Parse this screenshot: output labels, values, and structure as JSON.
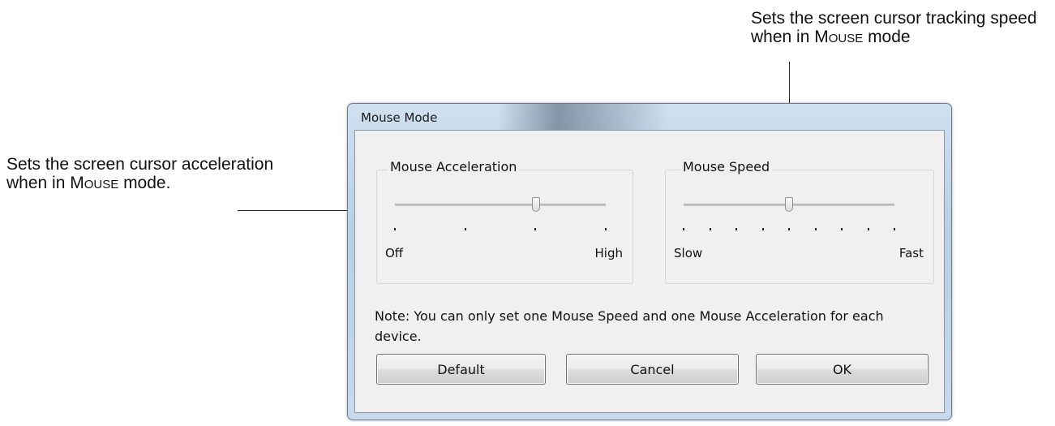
{
  "callouts": {
    "left_prefix": "Sets the screen cursor acceleration when in ",
    "left_mode": "Mouse",
    "left_suffix": " mode.",
    "right_prefix": "Sets the screen cursor tracking speed when in ",
    "right_mode": "Mouse",
    "right_suffix": " mode"
  },
  "dialog": {
    "title": "Mouse Mode",
    "acceleration": {
      "label": "Mouse Acceleration",
      "min_label": "Off",
      "max_label": "High",
      "tick_count": 4,
      "value_fraction": 0.67
    },
    "speed": {
      "label": "Mouse Speed",
      "min_label": "Slow",
      "max_label": "Fast",
      "tick_count": 9,
      "value_fraction": 0.5
    },
    "note": "Note: You can only set one Mouse Speed and one Mouse Acceleration for each device.",
    "buttons": {
      "default": "Default",
      "cancel": "Cancel",
      "ok": "OK"
    }
  }
}
